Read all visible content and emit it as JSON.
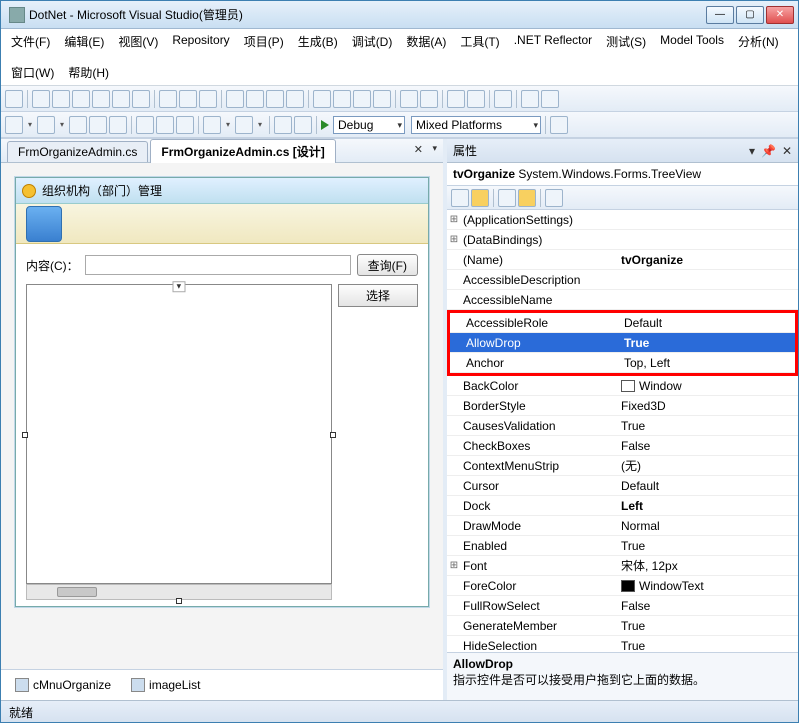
{
  "window": {
    "title": "DotNet - Microsoft Visual Studio(管理员)"
  },
  "menu": {
    "file": "文件(F)",
    "edit": "编辑(E)",
    "view": "视图(V)",
    "repository": "Repository",
    "project": "项目(P)",
    "build": "生成(B)",
    "debug": "调试(D)",
    "data": "数据(A)",
    "tools": "工具(T)",
    "reflector": ".NET Reflector",
    "test": "测试(S)",
    "model": "Model Tools",
    "analyze": "分析(N)",
    "window": "窗口(W)",
    "help": "帮助(H)"
  },
  "toolbar2": {
    "config": "Debug",
    "platform": "Mixed Platforms"
  },
  "tabs": {
    "tab0": "FrmOrganizeAdmin.cs",
    "tab1": "FrmOrganizeAdmin.cs [设计]"
  },
  "form": {
    "title": "组织机构（部门）管理",
    "content_label": "内容(C)：",
    "search_btn": "查询(F)",
    "select_col": "选择"
  },
  "tray": {
    "menu": "cMnuOrganize",
    "imagelist": "imageList"
  },
  "panel": {
    "title": "属性",
    "obj_name": "tvOrganize",
    "obj_type": "System.Windows.Forms.TreeView"
  },
  "props": {
    "appsettings": "(ApplicationSettings)",
    "databindings": "(DataBindings)",
    "name_lbl": "(Name)",
    "name_val": "tvOrganize",
    "accdesc": "AccessibleDescription",
    "accname": "AccessibleName",
    "accrole": "AccessibleRole",
    "accrole_val": "Default",
    "allowdrop": "AllowDrop",
    "allowdrop_val": "True",
    "anchor": "Anchor",
    "anchor_val": "Top, Left",
    "backcolor": "BackColor",
    "backcolor_val": "Window",
    "borderstyle": "BorderStyle",
    "borderstyle_val": "Fixed3D",
    "causesval": "CausesValidation",
    "causesval_val": "True",
    "checkboxes": "CheckBoxes",
    "checkboxes_val": "False",
    "ctxmenu": "ContextMenuStrip",
    "ctxmenu_val": "(无)",
    "cursor": "Cursor",
    "cursor_val": "Default",
    "dock": "Dock",
    "dock_val": "Left",
    "drawmode": "DrawMode",
    "drawmode_val": "Normal",
    "enabled": "Enabled",
    "enabled_val": "True",
    "font": "Font",
    "font_val": "宋体, 12px",
    "forecolor": "ForeColor",
    "forecolor_val": "WindowText",
    "fullrow": "FullRowSelect",
    "fullrow_val": "False",
    "genmember": "GenerateMember",
    "genmember_val": "True",
    "hidesel": "HideSelection",
    "hidesel_val": "True"
  },
  "desc": {
    "name": "AllowDrop",
    "text": "指示控件是否可以接受用户拖到它上面的数据。"
  },
  "status": {
    "text": "就绪"
  }
}
